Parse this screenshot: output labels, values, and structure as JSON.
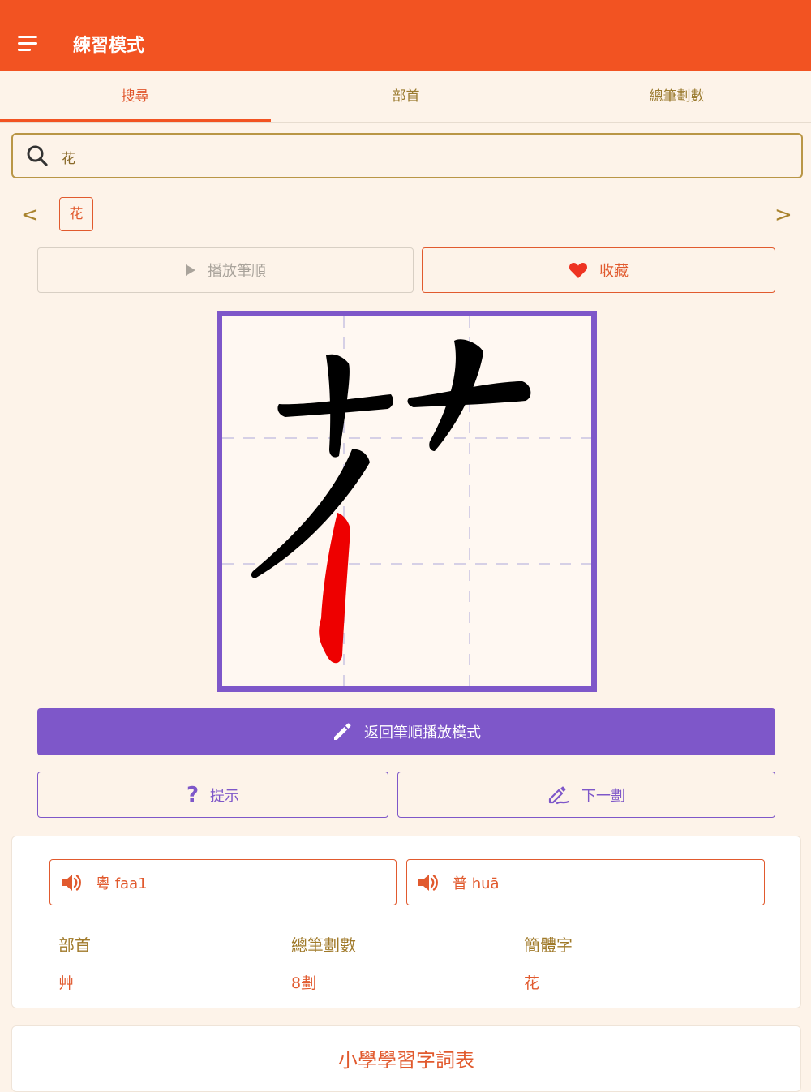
{
  "appbar": {
    "title": "練習模式"
  },
  "tabs": [
    {
      "label": "搜尋",
      "active": true
    },
    {
      "label": "部首",
      "active": false
    },
    {
      "label": "總筆劃數",
      "active": false
    }
  ],
  "search": {
    "value": "花"
  },
  "chips": [
    {
      "label": "花"
    }
  ],
  "nav": {
    "prev": "<",
    "next": ">"
  },
  "actions": {
    "play_label": "播放筆順",
    "favorite_label": "收藏",
    "back_label": "返回筆順播放模式",
    "hint_label": "提示",
    "next_label": "下一劃"
  },
  "pronunciation": {
    "cantonese": "粵 faa1",
    "mandarin": "普 huā"
  },
  "info": {
    "radical_label": "部首",
    "radical_value": "艸",
    "strokes_label": "總筆劃數",
    "strokes_value": "8劃",
    "simplified_label": "簡體字",
    "simplified_value": "花"
  },
  "word_list": {
    "title": "小學學習字詞表"
  },
  "colors": {
    "primary": "#f25322",
    "accent": "#7e57c9",
    "background": "#fdf3e9",
    "current_stroke": "#ee0000"
  }
}
